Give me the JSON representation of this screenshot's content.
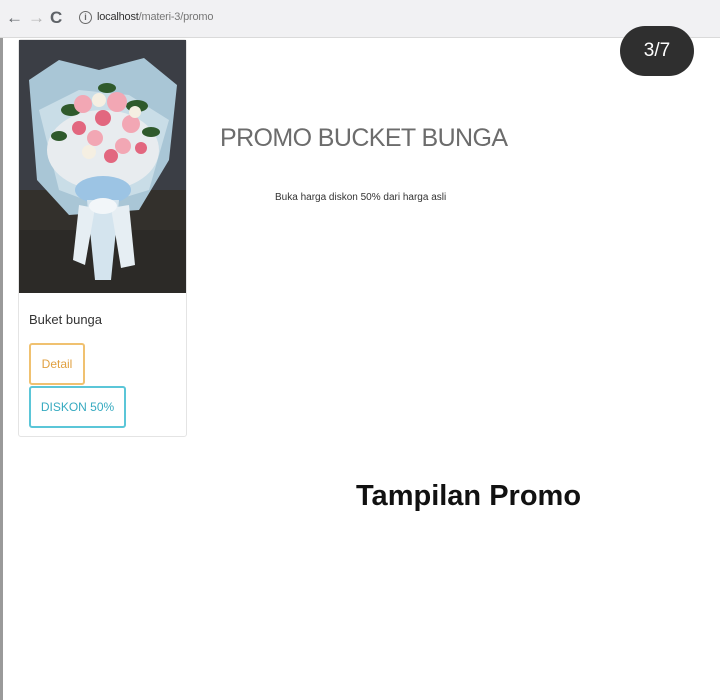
{
  "browser": {
    "url_host": "localhost",
    "url_path": "/materi-3/promo"
  },
  "slide_counter": "3/7",
  "product": {
    "name": "Buket bunga",
    "detail_button": "Detail",
    "discount_button": "DISKON 50%"
  },
  "promo": {
    "title": "PROMO BUCKET BUNGA",
    "subtitle": "Buka harga diskon 50% dari harga asli"
  },
  "caption": "Tampilan Promo",
  "colors": {
    "detail_border": "#f0c170",
    "discount_border": "#5bc6d8",
    "badge_bg": "#2f2f2f"
  },
  "icons": [
    "back-arrow-icon",
    "forward-arrow-icon",
    "reload-icon",
    "info-icon"
  ]
}
